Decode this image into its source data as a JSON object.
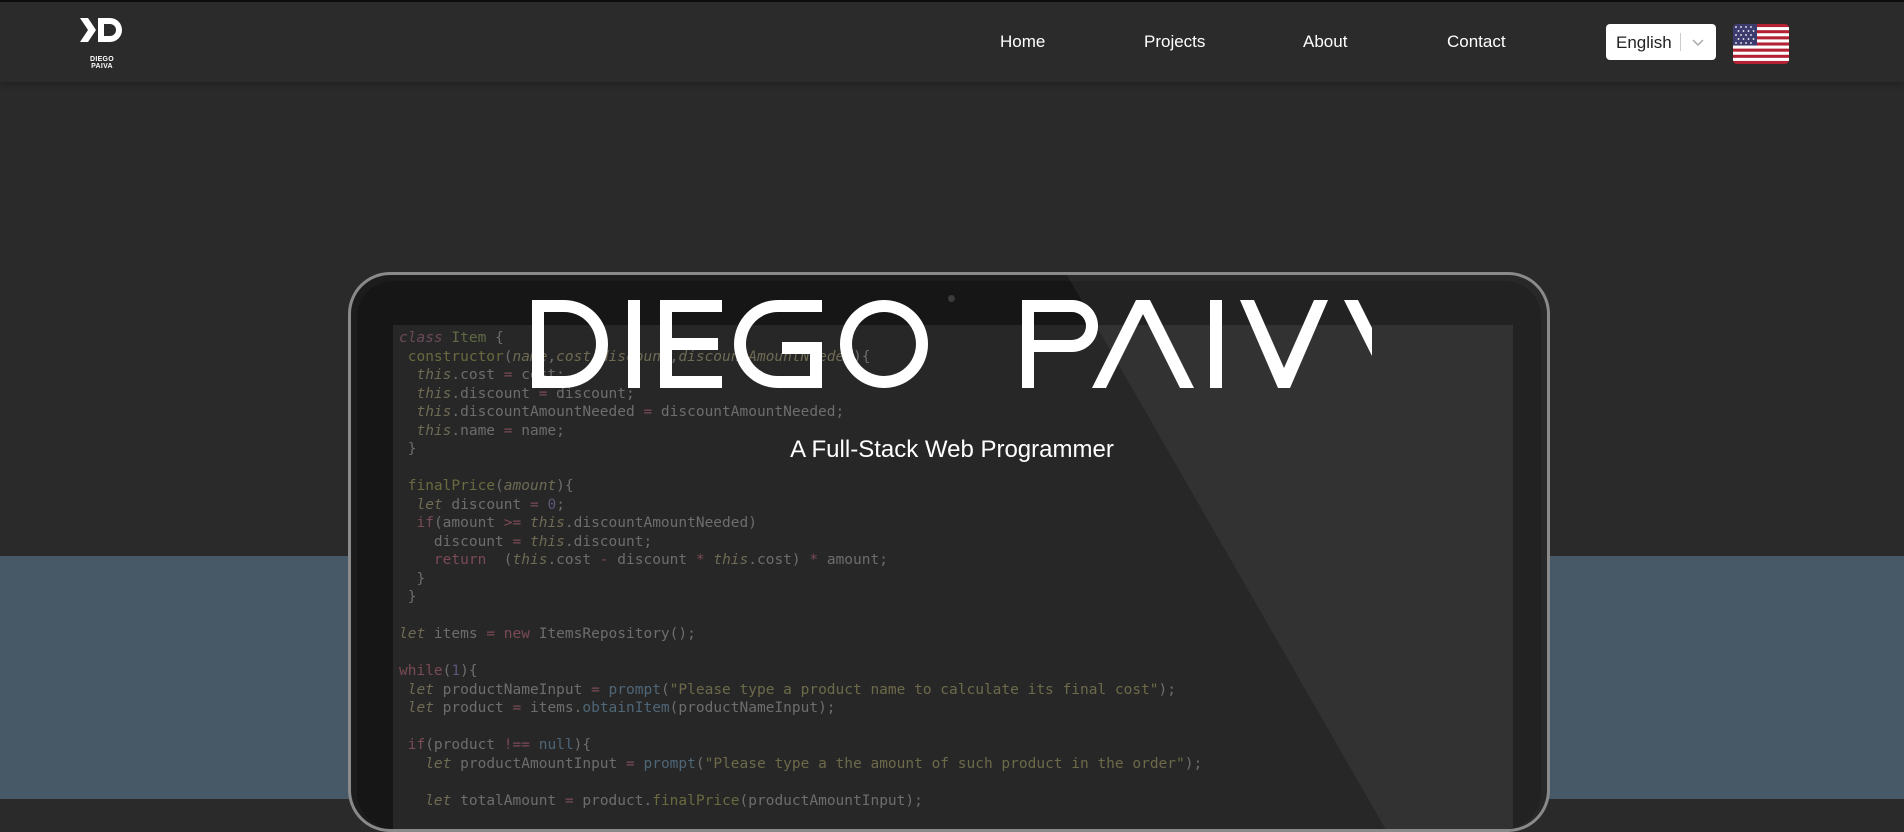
{
  "brand": {
    "logo_icon": "dp-logo-icon",
    "logo_text": "DIEGO PAIVA"
  },
  "nav": {
    "items": [
      {
        "label": "Home"
      },
      {
        "label": "Projects"
      },
      {
        "label": "About"
      },
      {
        "label": "Contact"
      }
    ]
  },
  "language": {
    "selected": "English",
    "chevron_icon": "chevron-down-icon",
    "flag_icon": "us-flag-icon"
  },
  "hero": {
    "title": "DIEGO PAIVA",
    "subtitle": "A Full-Stack Web Programmer"
  },
  "colors": {
    "background": "#2a2a2a",
    "navbar": "#2b2b2b",
    "blue_band": "#475867",
    "text": "#ffffff"
  },
  "code_lines": [
    "class Item {",
    " constructor(name,cost,discount,discountAmountNeeded){",
    "  this.cost = cost;",
    "  this.discount = discount;",
    "  this.discountAmountNeeded = discountAmountNeeded;",
    "  this.name = name;",
    " }",
    "",
    " finalPrice(amount){",
    "  let discount = 0;",
    "  if(amount >= this.discountAmountNeeded)",
    "    discount = this.discount;",
    "    return  (this.cost - discount * this.cost) * amount;",
    "  }",
    " }",
    "",
    "let items = new ItemsRepository();",
    "",
    "while(1){",
    " let productNameInput = prompt(\"Please type a product name to calculate its final cost\");",
    " let product = items.obtainItem(productNameInput);",
    "",
    " if(product !== null){",
    "   let productAmountInput = prompt(\"Please type a the amount of such product in the order\");",
    "",
    "   let totalAmount = product.finalPrice(productAmountInput);"
  ]
}
